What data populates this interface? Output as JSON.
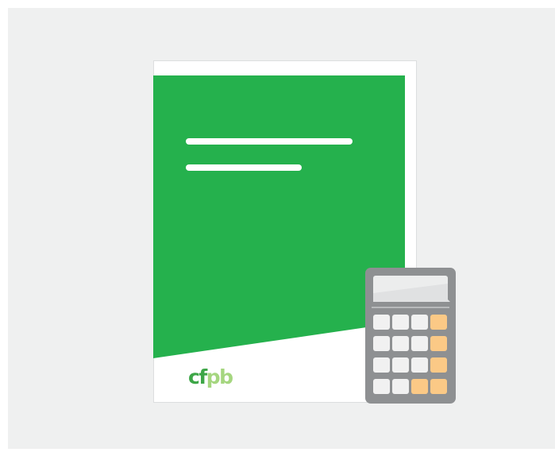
{
  "illustration": {
    "logo_text": "cfpb",
    "colors": {
      "background": "#eff0f0",
      "page": "#ffffff",
      "cover_green": "#25b14d",
      "logo_green": "#3da647",
      "logo_light_green": "#a5d67f",
      "calculator_body": "#8e9092",
      "calculator_screen": "#eceded",
      "key_gray": "#f1f1f1",
      "key_orange": "#fbc986"
    },
    "icons": [
      "document-icon",
      "calculator-icon"
    ]
  }
}
